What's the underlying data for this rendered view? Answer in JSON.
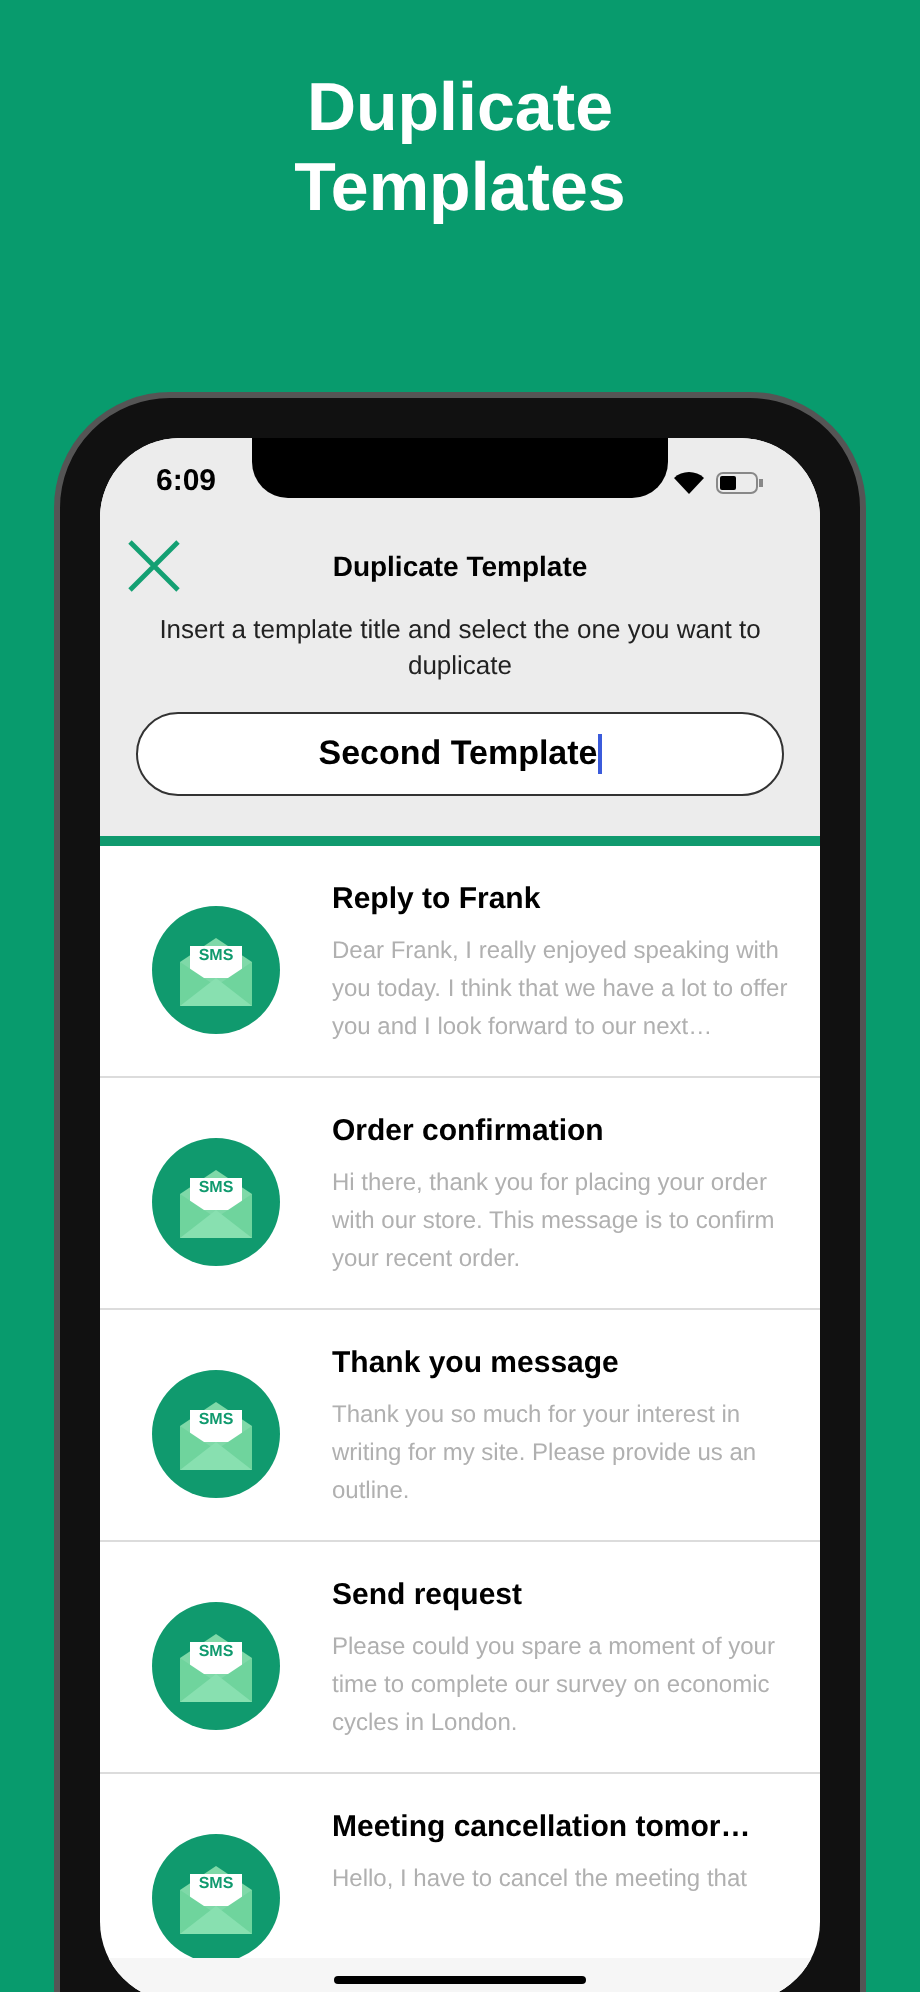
{
  "headline": "Duplicate Templates",
  "status_bar": {
    "time": "6:09"
  },
  "header": {
    "title": "Duplicate Template",
    "instruction": "Insert a template title and select the one you want to duplicate"
  },
  "title_field": {
    "value": "Second Template",
    "focused": true
  },
  "templates": [
    {
      "title": "Reply to Frank",
      "body": "Dear Frank, I really enjoyed speaking with you today. I think that we have a lot to offer you and I look forward to our next…",
      "icon_label": "SMS"
    },
    {
      "title": "Order confirmation",
      "body": "Hi there, thank you for placing your order with our store. This message is to confirm your recent order.",
      "icon_label": "SMS"
    },
    {
      "title": "Thank you message",
      "body": "Thank you so much for your interest in writing for my site. Please provide us an outline.",
      "icon_label": "SMS"
    },
    {
      "title": "Send request",
      "body": "Please could you spare a moment of your time to complete our survey on economic cycles in London.",
      "icon_label": "SMS"
    },
    {
      "title": "Meeting cancellation tomor…",
      "body": "Hello, I have to cancel the meeting that",
      "icon_label": "SMS"
    }
  ]
}
